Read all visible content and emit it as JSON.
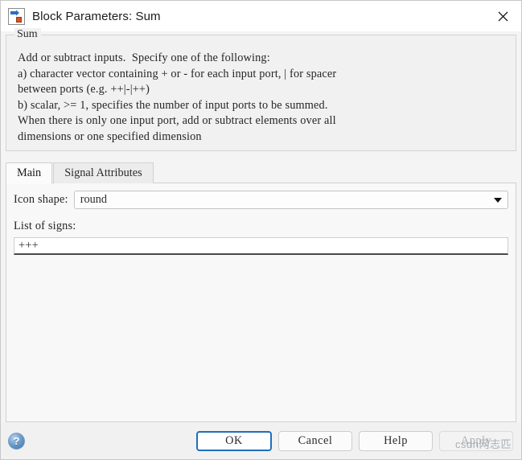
{
  "window": {
    "title": "Block Parameters: Sum",
    "icon": "simulink-block-icon",
    "close_icon": "close-icon"
  },
  "group": {
    "legend": "Sum",
    "description": "Add or subtract inputs.  Specify one of the following:\na) character vector containing + or - for each input port, | for spacer\nbetween ports (e.g. ++|-|++)\nb) scalar, >= 1, specifies the number of input ports to be summed.\nWhen there is only one input port, add or subtract elements over all\ndimensions or one specified dimension"
  },
  "tabs": [
    {
      "label": "Main",
      "active": true
    },
    {
      "label": "Signal Attributes",
      "active": false
    }
  ],
  "main_tab": {
    "icon_shape": {
      "label": "Icon shape:",
      "value": "round",
      "caret_icon": "chevron-down-icon"
    },
    "list_of_signs": {
      "label": "List of signs:",
      "value": "+++",
      "placeholder": ""
    }
  },
  "footer": {
    "help_icon": "help-question-icon",
    "buttons": [
      {
        "label": "OK",
        "style": "primary",
        "disabled": false
      },
      {
        "label": "Cancel",
        "style": "normal",
        "disabled": false
      },
      {
        "label": "Help",
        "style": "normal",
        "disabled": false
      },
      {
        "label": "Apply",
        "style": "normal",
        "disabled": true
      }
    ]
  },
  "watermark": {
    "text": "csdn网志匹"
  },
  "colors": {
    "accent": "#1d6fbc",
    "dialog_bg": "#f4f4f4",
    "panel_bg": "#f8f8f8",
    "border": "#d0d0d0"
  }
}
